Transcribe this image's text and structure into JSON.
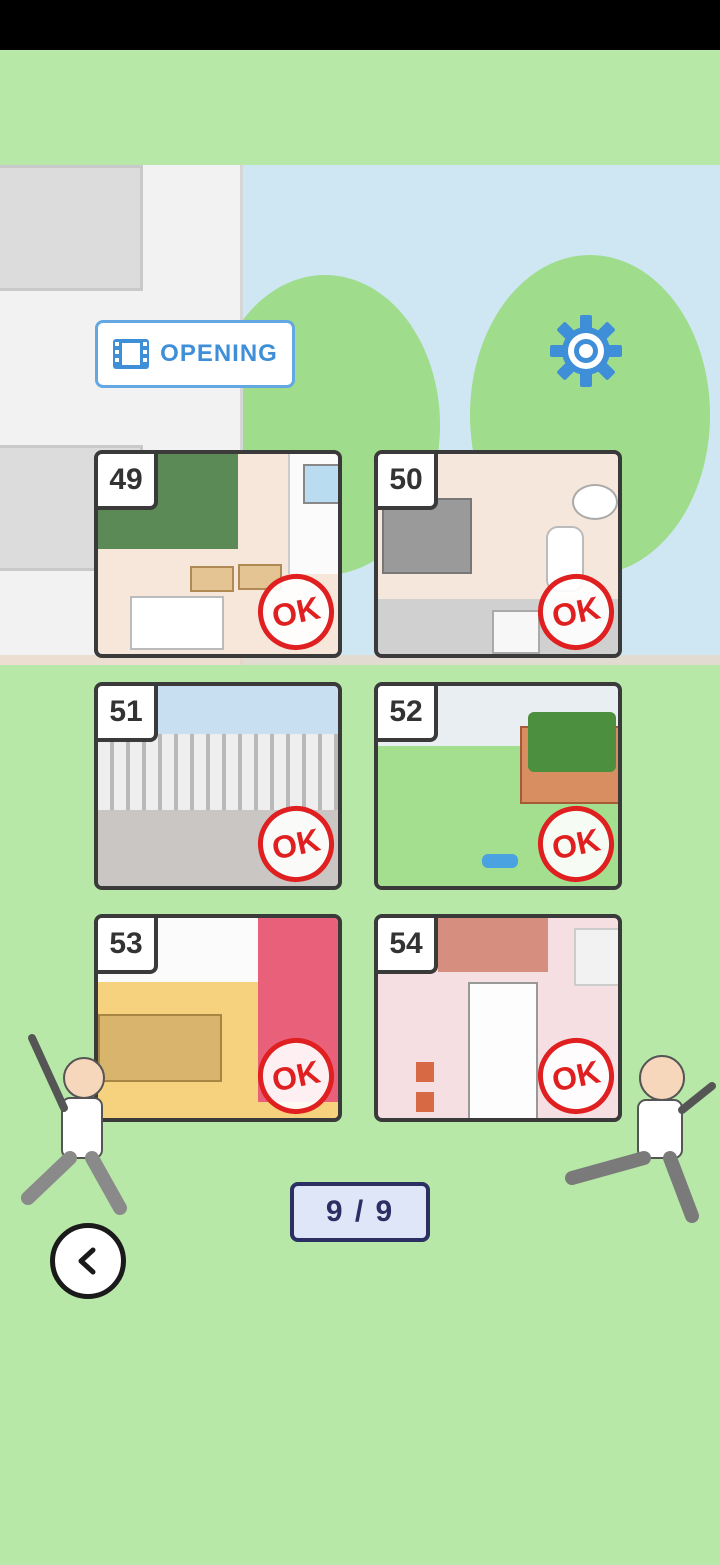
{
  "toolbar": {
    "opening_label": "OPENING",
    "opening_icon": "film-icon",
    "settings_icon": "gear-icon",
    "accent_color": "#3f8fd8"
  },
  "levels": [
    {
      "number": "49",
      "status": "OK"
    },
    {
      "number": "50",
      "status": "OK"
    },
    {
      "number": "51",
      "status": "OK"
    },
    {
      "number": "52",
      "status": "OK"
    },
    {
      "number": "53",
      "status": "OK"
    },
    {
      "number": "54",
      "status": "OK"
    }
  ],
  "pagination": {
    "label": "9 / 9"
  },
  "navigation": {
    "back_icon": "chevron-left-icon"
  }
}
